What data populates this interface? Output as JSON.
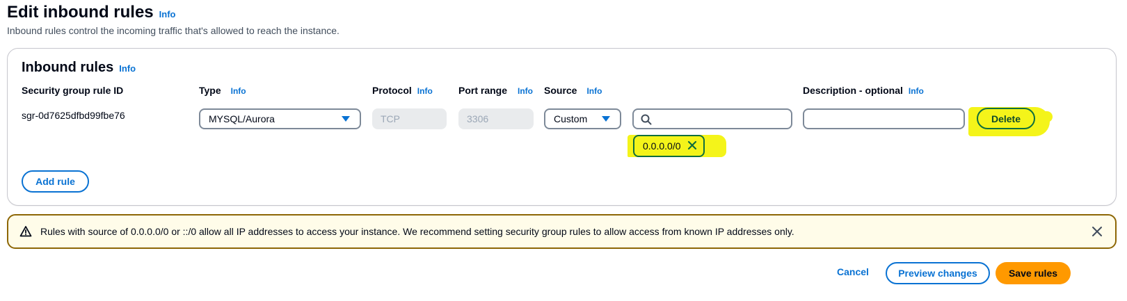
{
  "page": {
    "title": "Edit inbound rules",
    "info": "Info",
    "description": "Inbound rules control the incoming traffic that's allowed to reach the instance."
  },
  "container": {
    "title": "Inbound rules",
    "info": "Info"
  },
  "columns": {
    "rule_id": "Security group rule ID",
    "type": "Type",
    "protocol": "Protocol",
    "port_range": "Port range",
    "source": "Source",
    "description": "Description - optional",
    "info": "Info"
  },
  "rule": {
    "id": "sgr-0d7625dfbd99fbe76",
    "type": "MYSQL/Aurora",
    "protocol": "TCP",
    "port_range": "3306",
    "source_type": "Custom",
    "source_search_value": "",
    "source_token": "0.0.0.0/0",
    "description_value": "",
    "delete_label": "Delete"
  },
  "add_rule_label": "Add rule",
  "alert": {
    "text": "Rules with source of 0.0.0.0/0 or ::/0 allow all IP addresses to access your instance. We recommend setting security group rules to allow access from known IP addresses only."
  },
  "footer": {
    "cancel_label": "Cancel",
    "preview_label": "Preview changes",
    "save_label": "Save rules"
  },
  "icons": {
    "dropdown": "caret-down-icon",
    "search": "search-icon",
    "remove_token": "close-icon",
    "warning": "warning-icon",
    "dismiss": "close-icon"
  },
  "colors": {
    "accent": "#0972d3",
    "primary_button": "#ff9900",
    "highlight": "#f4f41a",
    "warning_border": "#8d6605",
    "warning_bg": "#fffce9"
  }
}
